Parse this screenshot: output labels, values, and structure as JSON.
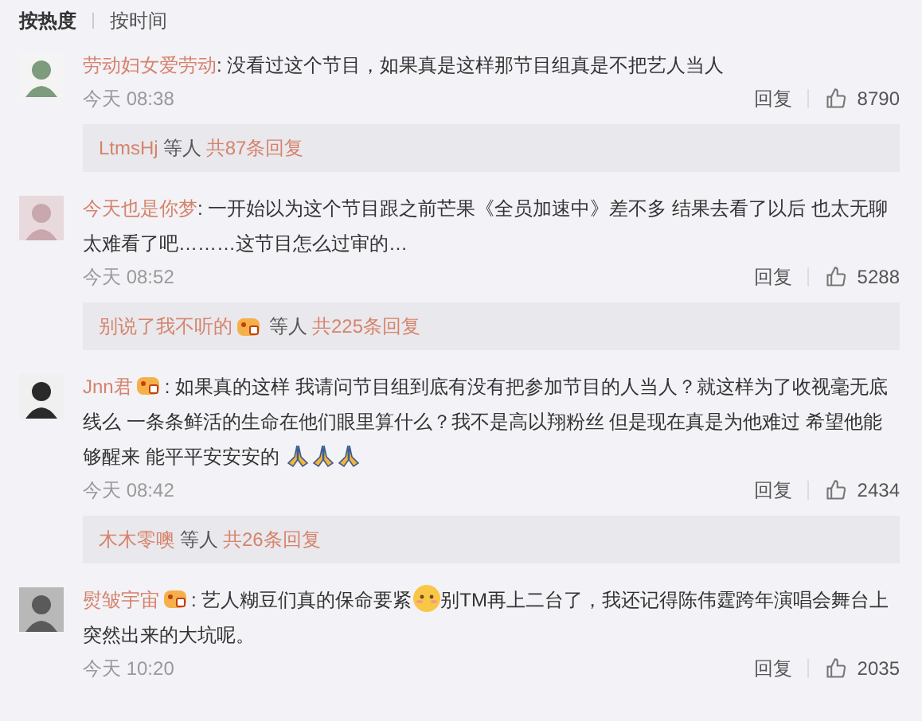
{
  "sort_tabs": [
    {
      "label": "按热度",
      "selected": true
    },
    {
      "label": "按时间",
      "selected": false
    }
  ],
  "comments": [
    {
      "user": "劳动妇女爱劳动",
      "badge": false,
      "body": [
        {
          "kind": "text",
          "text": ": 没看过这个节目，如果真是这样那节目组真是不把艺人当人"
        }
      ],
      "time": "今天 08:38",
      "reply_label": "回复",
      "likes": "8790",
      "replies": {
        "user": "LtmsHj",
        "badge": false,
        "others": "等人",
        "total": "共87条回复"
      }
    },
    {
      "user": "今天也是你梦",
      "badge": false,
      "body": [
        {
          "kind": "text",
          "text": ": 一开始以为这个节目跟之前芒果《全员加速中》差不多 结果去看了以后 也太无聊太难看了吧………这节目怎么过审的…"
        }
      ],
      "time": "今天 08:52",
      "reply_label": "回复",
      "likes": "5288",
      "replies": {
        "user": "别说了我不听的",
        "badge": true,
        "others": "等人",
        "total": "共225条回复"
      }
    },
    {
      "user": "Jnn君",
      "badge": true,
      "body": [
        {
          "kind": "text",
          "text": ": 如果真的这样 我请问节目组到底有没有把参加节目的人当人？就这样为了收视毫无底线么 一条条鲜活的生命在他们眼里算什么？我不是高以翔粉丝 但是现在真是为他难过 希望他能够醒来 能平平安安安的 "
        },
        {
          "kind": "pray"
        },
        {
          "kind": "pray"
        },
        {
          "kind": "pray"
        }
      ],
      "time": "今天 08:42",
      "reply_label": "回复",
      "likes": "2434",
      "replies": {
        "user": "木木零噢",
        "badge": false,
        "others": "等人",
        "total": "共26条回复"
      }
    },
    {
      "user": "熨皱宇宙",
      "badge": true,
      "body": [
        {
          "kind": "text",
          "text": ": 艺人糊豆们真的保命要紧"
        },
        {
          "kind": "smiley"
        },
        {
          "kind": "text",
          "text": "别TM再上二台了，我还记得陈伟霆跨年演唱会舞台上突然出来的大坑呢。"
        }
      ],
      "time": "今天 10:20",
      "reply_label": "回复",
      "likes": "2035"
    }
  ]
}
